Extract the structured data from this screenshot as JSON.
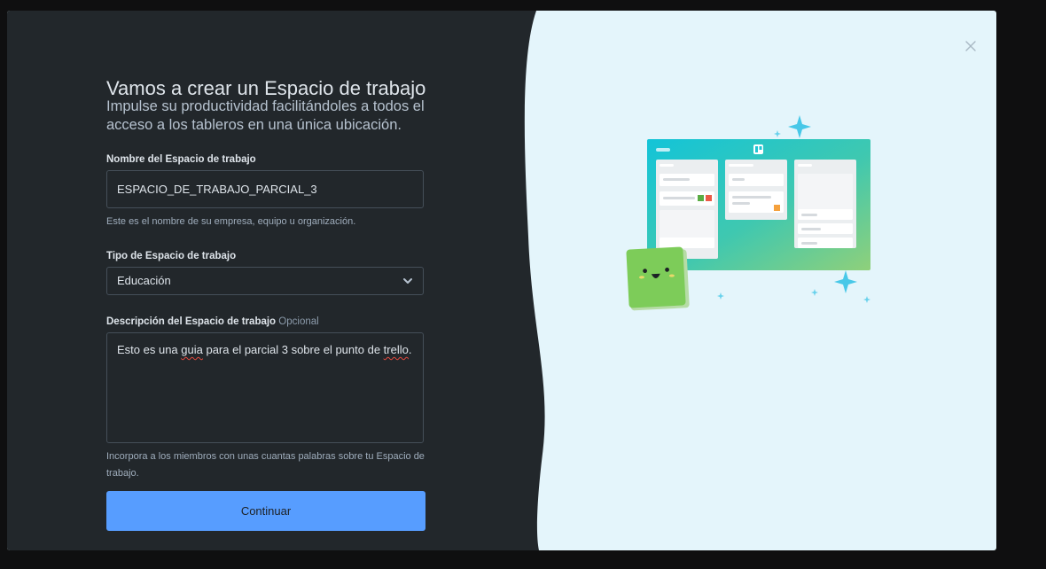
{
  "form": {
    "title": "Vamos a crear un Espacio de trabajo",
    "subtitle": "Impulse su productividad facilitándoles a todos el acceso a los tableros en una única ubicación.",
    "name_label": "Nombre del Espacio de trabajo",
    "name_value": "ESPACIO_DE_TRABAJO_PARCIAL_3",
    "name_help": "Este es el nombre de su empresa, equipo u organización.",
    "type_label": "Tipo de Espacio de trabajo",
    "type_value": "Educación",
    "desc_label": "Descripción del Espacio de trabajo",
    "desc_optional": "Opcional",
    "desc_value_pre": "Esto es una ",
    "desc_value_w1": "guia",
    "desc_value_mid": " para el parcial 3 sobre el punto de ",
    "desc_value_w2": "trello",
    "desc_value_post": ".",
    "desc_help": "Incorpora a los miembros con unas cuantas palabras sobre tu Espacio de trabajo.",
    "continue_label": "Continuar"
  },
  "colors": {
    "left_bg": "#22272b",
    "right_bg": "#e4f5fb",
    "button": "#579dff"
  },
  "icons": {
    "close": "close-icon",
    "chevron": "chevron-down-icon",
    "logo": "trello-logo-icon",
    "sparkle": "sparkle-icon"
  }
}
